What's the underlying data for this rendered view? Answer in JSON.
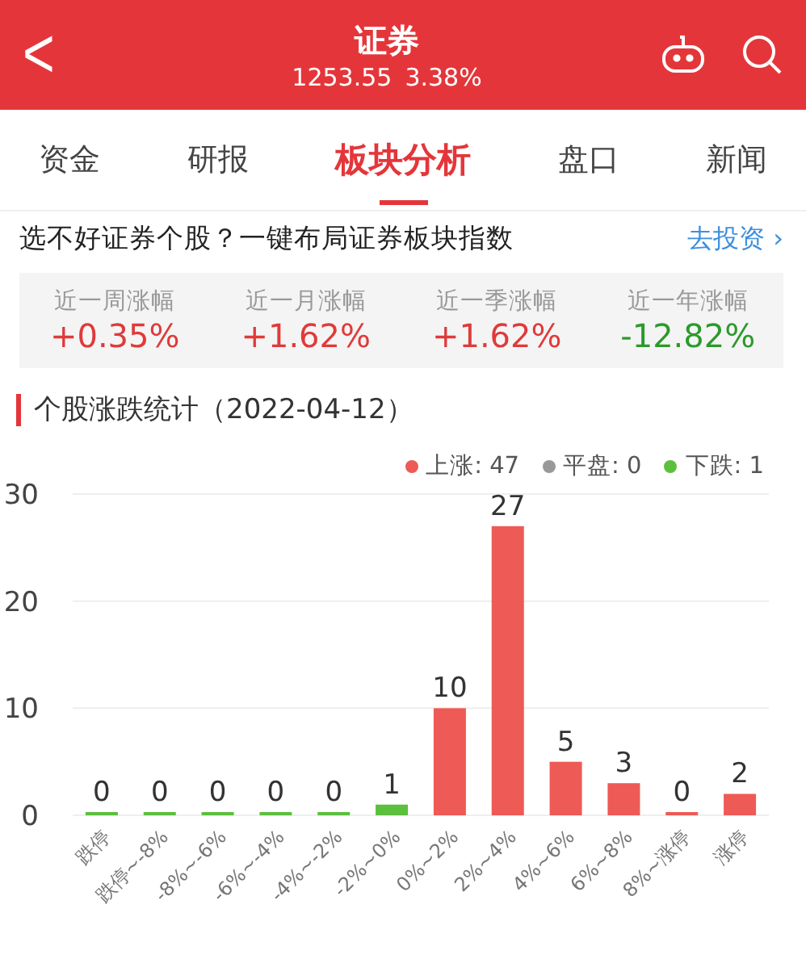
{
  "header": {
    "back": "<",
    "title": "证券",
    "price": "1253.55",
    "change": "3.38%"
  },
  "tabs": [
    {
      "label": "资金",
      "selected": false
    },
    {
      "label": "研报",
      "selected": false
    },
    {
      "label": "板块分析",
      "selected": true
    },
    {
      "label": "盘口",
      "selected": false
    },
    {
      "label": "新闻",
      "selected": false
    }
  ],
  "promo": {
    "text": "选不好证券个股？一键布局证券板块指数",
    "link": "去投资",
    "chevron": "›"
  },
  "stats": [
    {
      "label": "近一周涨幅",
      "value": "+0.35%",
      "color": "#e03a3a"
    },
    {
      "label": "近一月涨幅",
      "value": "+1.62%",
      "color": "#e03a3a"
    },
    {
      "label": "近一季涨幅",
      "value": "+1.62%",
      "color": "#e03a3a"
    },
    {
      "label": "近一年涨幅",
      "value": "-12.82%",
      "color": "#2a9a2a"
    }
  ],
  "section": {
    "title": "个股涨跌统计（2022-04-12）"
  },
  "legend": [
    {
      "count": ": 47"
    },
    {
      "count": ": 0"
    },
    {
      "count": ": 1"
    }
  ],
  "chart_data": {
    "type": "bar",
    "stacked": true,
    "data_labels": true,
    "ylim": [
      0,
      30
    ],
    "yticks": [
      0,
      10,
      20,
      30
    ],
    "categories": [
      "跌停",
      "跌停~-8%",
      "-8%~-6%",
      "-6%~-4%",
      "-4%~-2%",
      "-2%~0%",
      "0%~2%",
      "2%~4%",
      "4%~6%",
      "6%~8%",
      "8%~涨停",
      "涨停"
    ],
    "series": [
      {
        "name": "上涨",
        "color": "#ee5a55",
        "values": [
          null,
          null,
          null,
          null,
          null,
          null,
          10,
          27,
          5,
          3,
          0,
          2
        ]
      },
      {
        "name": "平盘",
        "color": "#999999",
        "values": [
          null,
          null,
          null,
          null,
          null,
          null,
          null,
          null,
          null,
          null,
          null,
          null
        ]
      },
      {
        "name": "下跌",
        "color": "#5cbf3e",
        "values": [
          0,
          0,
          0,
          0,
          0,
          1,
          null,
          null,
          null,
          null,
          null,
          null
        ]
      }
    ]
  }
}
